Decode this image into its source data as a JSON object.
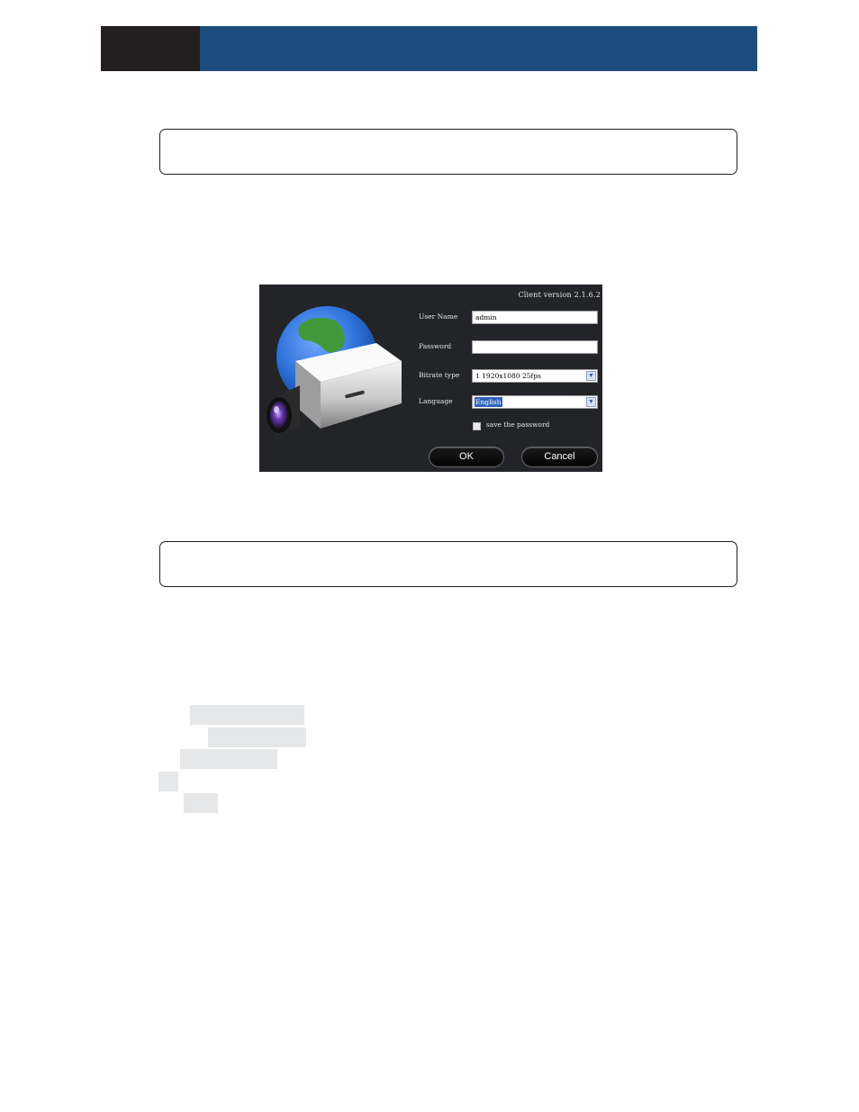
{
  "dialog": {
    "version": "Client version 2.1.6.2",
    "labels": {
      "user_name": "User Name",
      "password": "Password",
      "bitrate_type": "Bitrate type",
      "language": "Language"
    },
    "user_name_value": "admin",
    "password_value": "",
    "bitrate_value": "1 1920x1080 25fps",
    "language_value": "English",
    "save_password_label": "save the password",
    "save_password_checked": false,
    "ok_label": "OK",
    "cancel_label": "Cancel"
  },
  "colors": {
    "header_blue": "#1d4c7e",
    "header_dark": "#231f20",
    "dialog_bg": "#222428",
    "selection": "#2f62b8"
  }
}
